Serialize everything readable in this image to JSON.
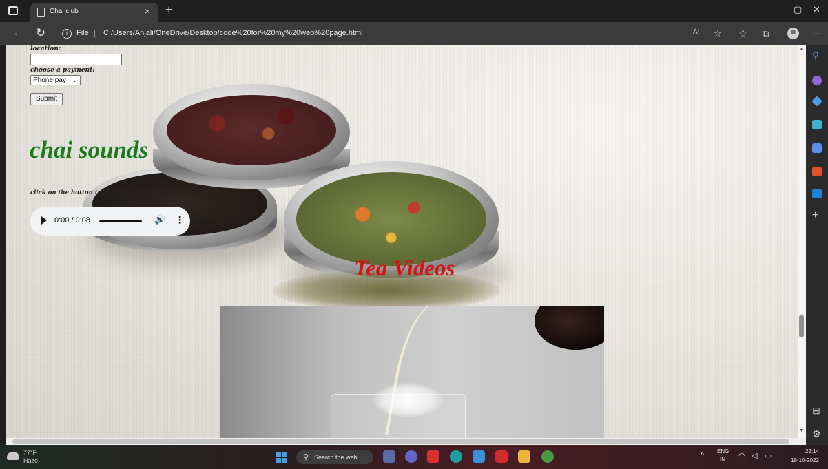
{
  "browser": {
    "tab_title": "Chai club",
    "tab_close": "×",
    "new_tab": "+",
    "window_controls": [
      "–",
      "▢",
      "✕"
    ],
    "url_scheme": "File",
    "url_separator": "|",
    "url": "C:/Users/Anjali/OneDrive/Desktop/code%20for%20my%20web%20page.html",
    "toolbar_icons": [
      "read-aloud-icon",
      "add-favorite-icon",
      "favorites-icon",
      "collections-icon",
      "profile-icon",
      "more-icon"
    ],
    "more_glyph": "···"
  },
  "page": {
    "location_label": "location:",
    "location_value": "",
    "payment_label": "choose a payment:",
    "payment_selected": "Phone pay",
    "submit_label": "Submit",
    "chai_title": "chai sounds",
    "instruction": "click on the button to play the sound",
    "audio": {
      "time": "0:00 / 0:08",
      "progress": 0
    },
    "videos_title": "Tea Videos",
    "colors": {
      "chai_title": "#1a7a1a",
      "videos_title": "#d21414"
    }
  },
  "sidebar": {
    "icons": [
      "search-icon",
      "copilot-icon",
      "shopping-tag-icon",
      "toolbox-icon",
      "games-icon",
      "office-icon",
      "outlook-icon",
      "add-icon",
      "split-screen-icon",
      "settings-icon"
    ]
  },
  "taskbar": {
    "weather_temp": "77°F",
    "weather_desc": "Haze",
    "search_placeholder": "Search the web",
    "apps": [
      "file-explorer-icon",
      "teams-chat-icon",
      "mcafee-icon",
      "edge-icon",
      "microsoft-store-icon",
      "wps-office-icon",
      "folder-icon",
      "chrome-icon"
    ],
    "lang_top": "ENG",
    "lang_bottom": "IN",
    "time": "22:14",
    "date": "18-10-2022"
  }
}
